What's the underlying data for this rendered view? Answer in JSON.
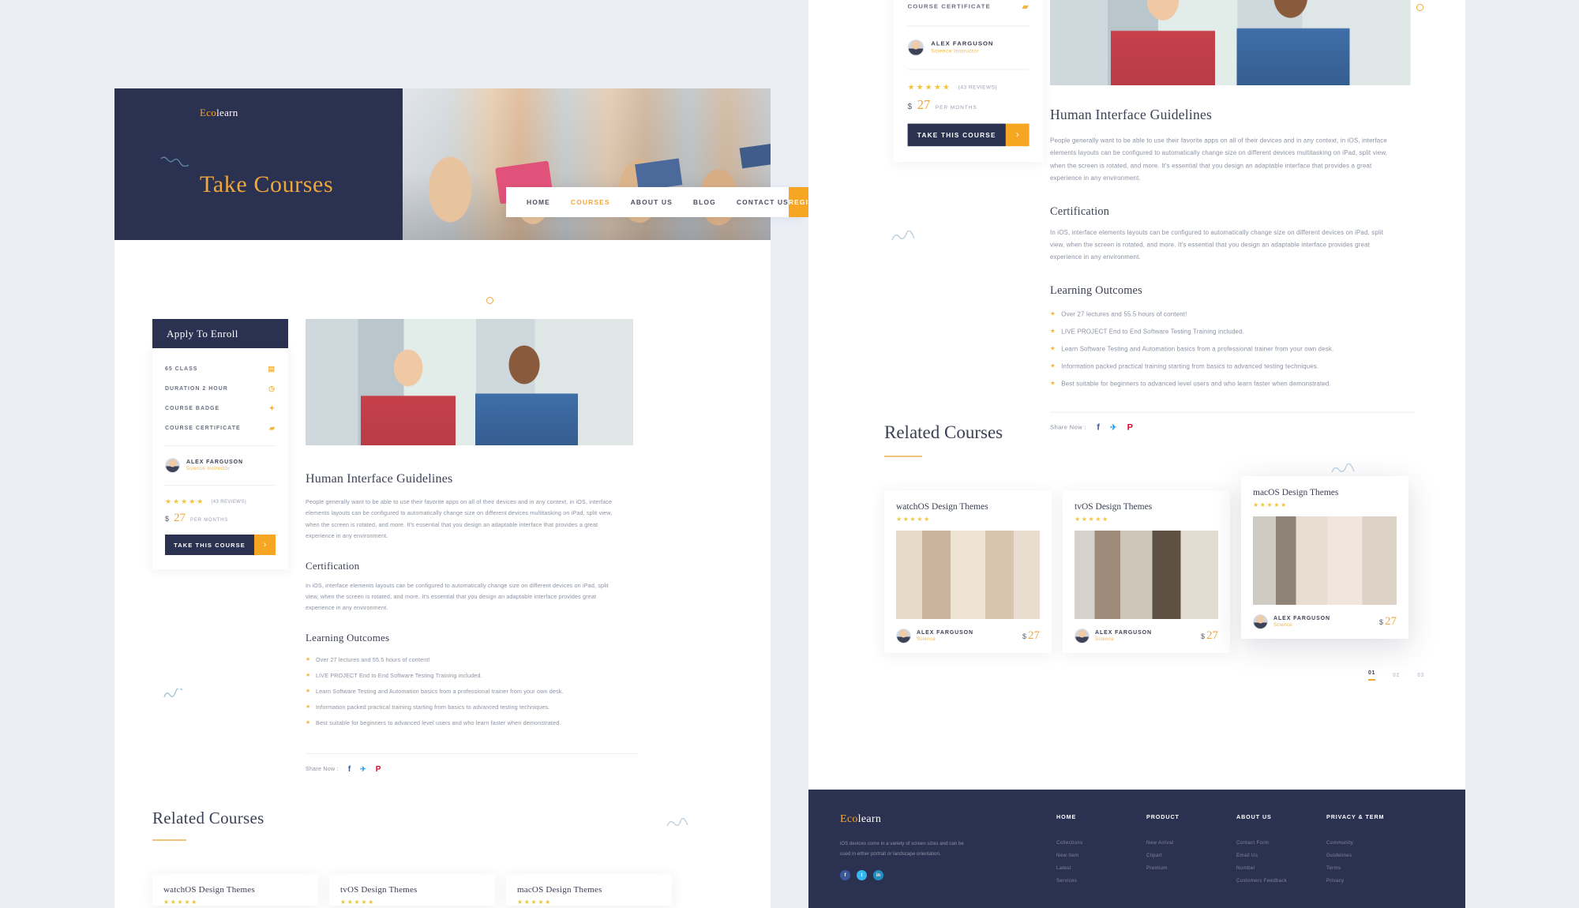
{
  "brand": {
    "name_first": "Eco",
    "name_last": "learn"
  },
  "nav": {
    "items": [
      {
        "label": "HOME",
        "active": false
      },
      {
        "label": "COURSES",
        "active": true
      },
      {
        "label": "ABOUT US",
        "active": false
      },
      {
        "label": "BLOG",
        "active": false
      },
      {
        "label": "CONTACT US",
        "active": false
      }
    ],
    "register_label": "REGISTER"
  },
  "hero": {
    "title": "Take Courses"
  },
  "enroll": {
    "header": "Apply To Enroll",
    "meta": [
      {
        "label": "65 CLASS",
        "icon": "calendar-icon",
        "glyph": "▤"
      },
      {
        "label": "DURATION 2 HOUR",
        "icon": "clock-icon",
        "glyph": "◷"
      },
      {
        "label": "COURSE BADGE",
        "icon": "badge-icon",
        "glyph": "✦"
      },
      {
        "label": "COURSE CERTIFICATE",
        "icon": "certificate-icon",
        "glyph": "▰"
      }
    ],
    "author_name": "ALEX FARGUSON",
    "author_role": "Science Instructor",
    "stars": "★★★★★",
    "reviews": "(43 REVIEWS)",
    "price_currency": "$",
    "price_value": "27",
    "price_period": "PER MONTHS",
    "cta_label": "TAKE THIS COURSE",
    "cta_arrow": "›"
  },
  "article": {
    "title": "Human Interface Guidelines",
    "intro": "People generally want to be able to use their favorite apps on all of their devices and in any context, in iOS, interface elements layouts can be configured to automatically change size on different devices multitasking on iPad, split view, when the screen is rotated, and more. It's essential that you design an adaptable interface that provides a great experience in any environment.",
    "certification_heading": "Certification",
    "certification_text": "In iOS, interface elements layouts can be configured to automatically change size on different devices on iPad, split view, when the screen is rotated, and more. It's essential that you design an adaptable interface provides great experience in any environment.",
    "outcomes_heading": "Learning Outcomes",
    "outcomes": [
      "Over 27 lectures and 55.5 hours of content!",
      "LIVE PROJECT End to End Software Testing Training included.",
      "Learn Software Testing and Automation basics from a professional trainer from your own desk.",
      "Information packed practical training starting from basics to advanced testing techniques.",
      "Best suitable for beginners to advanced level users and who learn faster when demonstrated."
    ],
    "share_label": "Share Now :",
    "share": [
      {
        "name": "facebook-icon",
        "glyph": "f",
        "color": "#3b5998"
      },
      {
        "name": "twitter-icon",
        "glyph": "🐦",
        "color": "#1da1f2"
      },
      {
        "name": "pinterest-icon",
        "glyph": "P",
        "color": "#e60023"
      }
    ]
  },
  "related": {
    "title": "Related Courses",
    "cards": [
      {
        "title": "watchOS Design Themes",
        "stars": "★★★★★",
        "author": "ALEX FARGUSON",
        "role": "Science",
        "price_currency": "$",
        "price_value": "27"
      },
      {
        "title": "tvOS Design Themes",
        "stars": "★★★★★",
        "author": "ALEX FARGUSON",
        "role": "Science",
        "price_currency": "$",
        "price_value": "27"
      },
      {
        "title": "macOS Design Themes",
        "stars": "★★★★★",
        "author": "ALEX FARGUSON",
        "role": "Science",
        "price_currency": "$",
        "price_value": "27"
      }
    ],
    "pagination": [
      {
        "label": "01",
        "active": true
      },
      {
        "label": "02",
        "active": false
      },
      {
        "label": "03",
        "active": false
      }
    ]
  },
  "footer": {
    "description": "iOS devices come in a variety of screen sizes and can be used in either portrait or landscape orientation.",
    "social": [
      {
        "name": "facebook-icon",
        "glyph": "f",
        "color": "#3b5998"
      },
      {
        "name": "twitter-icon",
        "glyph": "t",
        "color": "#35b8ef"
      },
      {
        "name": "linkedin-icon",
        "glyph": "in",
        "color": "#1f8ec1"
      }
    ],
    "columns": [
      {
        "heading": "HOME",
        "links": [
          "Collections",
          "New Item",
          "Latest",
          "Services"
        ]
      },
      {
        "heading": "PRODUCT",
        "links": [
          "New Arrival",
          "Clipart",
          "Premium"
        ]
      },
      {
        "heading": "ABOUT US",
        "links": [
          "Contact Form",
          "Email Us",
          "Number",
          "Customers Feedback"
        ]
      },
      {
        "heading": "PRIVACY & TERM",
        "links": [
          "Community",
          "Guidelines",
          "Terms",
          "Privacy"
        ]
      }
    ]
  },
  "colors": {
    "navy": "#2b3150",
    "orange": "#f6a623",
    "gold": "#f0a73a",
    "star": "#f3c43f",
    "page_bg": "#eceef6",
    "body_text": "#8c92a3"
  }
}
